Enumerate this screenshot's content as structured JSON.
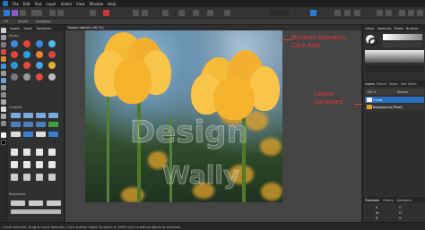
{
  "menu": {
    "items": [
      "File",
      "Edit",
      "Text",
      "Layer",
      "Select",
      "View",
      "Window",
      "Help"
    ]
  },
  "context_bar": {
    "items": [
      "Fill",
      "Stroke",
      "Snapping"
    ]
  },
  "left_panel": {
    "tabs": [
      "Assets",
      "Stock",
      "Transform"
    ],
    "section_styles": "Styles",
    "section_controls": "Controls",
    "section_keyboards": "Keyboards"
  },
  "document": {
    "tab_label": "flowers.afphoto (36.7%)"
  },
  "watermark": {
    "line1": "Design",
    "line2": "Wally"
  },
  "annotations": {
    "boolean": "Boolean operation\nClick Add",
    "layers": "Layers\ncombined"
  },
  "right_panel": {
    "top_tabs": [
      "Colour",
      "Swatches",
      "Stroke",
      "Brushes"
    ],
    "mid_tabs": [
      "Layers",
      "Effects",
      "Styles",
      "Text Styles"
    ],
    "blend_mode": "Normal",
    "opacity": "100 %",
    "layers": [
      {
        "name": "Curve",
        "selected": true
      },
      {
        "name": "Background (Pixel)",
        "selected": false
      }
    ],
    "transform_tabs": [
      "Transform",
      "History",
      "Navigator"
    ],
    "transform_fields": [
      "X:",
      "Y:",
      "W:",
      "H:",
      "R:",
      "S:"
    ]
  },
  "status": {
    "text": "Curve selected. Drag to move selection. Click another object to select it. Shift+click to add an object to selection."
  },
  "colors": {
    "accent": "#2a7fd4",
    "annotation": "#e23a3a",
    "tulip": "#f5b52e"
  }
}
